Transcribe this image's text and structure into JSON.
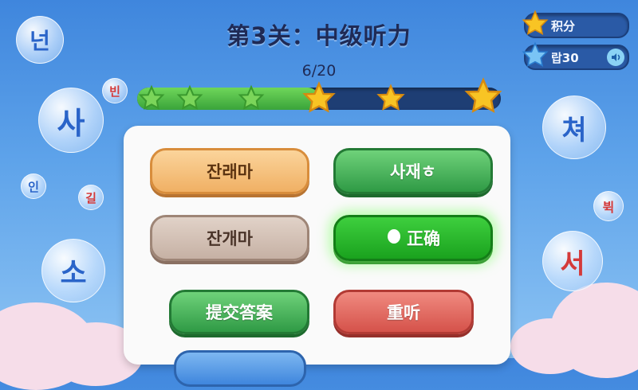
{
  "level_title": "第3关：中级听力",
  "progress": {
    "text": "6/20",
    "fraction": 0.3
  },
  "hud": {
    "points_label": "积分",
    "hearts_label": "랍30"
  },
  "buttons": {
    "opt1": "잔래마",
    "opt2": "사재ㅎ",
    "opt3": "잔개마",
    "opt4": "正确",
    "submit": "提交答案",
    "replay": "重听"
  },
  "bubbles": [
    "넌",
    "빈",
    "사",
    "인",
    "길",
    "소",
    "쳐",
    "뷕",
    "서"
  ],
  "colors": {
    "accent_green": "#2f9a45",
    "accent_red": "#d5524a",
    "star_gold": "#f8c424"
  }
}
